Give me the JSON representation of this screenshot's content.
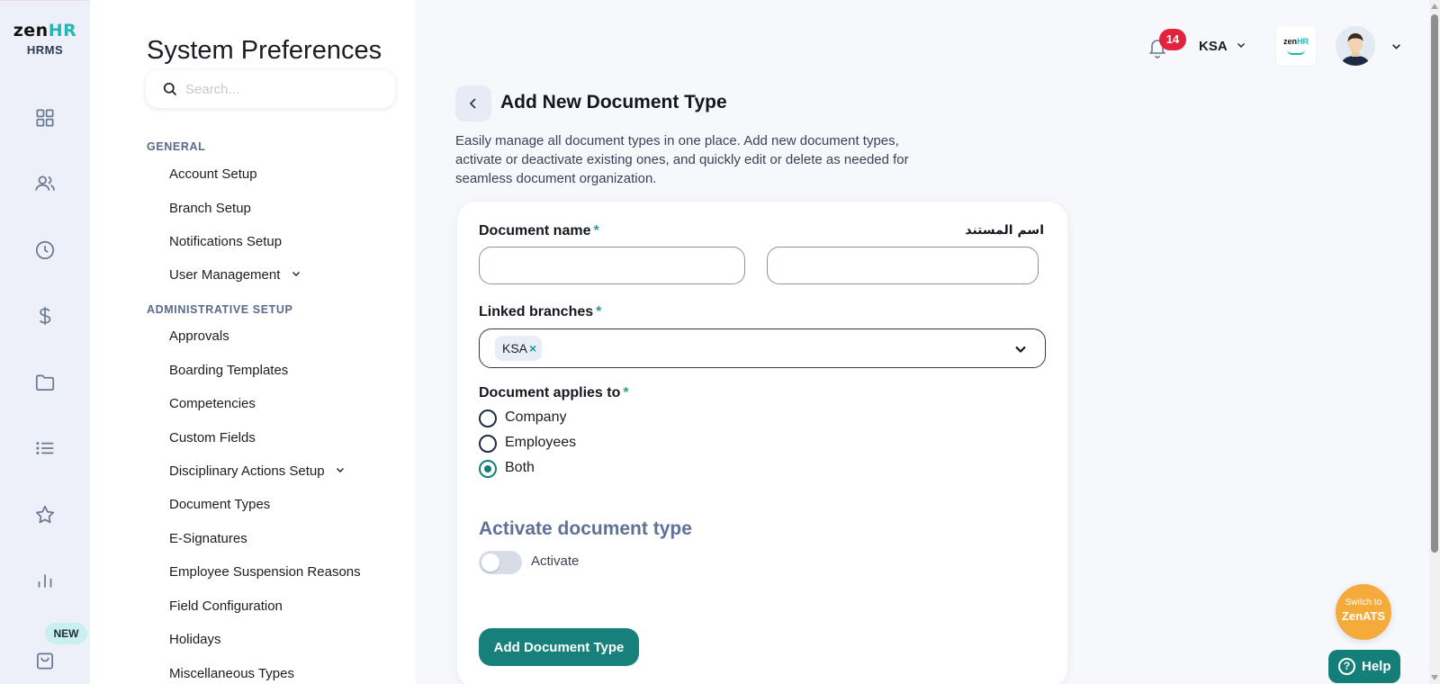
{
  "brand": {
    "logo_main": "zen",
    "logo_accent": "HR",
    "subtitle": "HRMS"
  },
  "rail": {
    "icons": [
      "dashboard-icon",
      "people-icon",
      "clock-icon",
      "dollar-icon",
      "folder-icon",
      "list-icon",
      "star-icon",
      "chart-icon",
      "bag-icon"
    ],
    "new_badge": "NEW"
  },
  "menu": {
    "title": "System Preferences",
    "search_placeholder": "Search...",
    "sections": [
      {
        "label": "GENERAL",
        "items": [
          "Account Setup",
          "Branch Setup",
          "Notifications Setup",
          "User Management"
        ]
      },
      {
        "label": "ADMINISTRATIVE SETUP",
        "items": [
          "Approvals",
          "Boarding Templates",
          "Competencies",
          "Custom Fields",
          "Disciplinary Actions Setup",
          "Document Types",
          "E-Signatures",
          "Employee Suspension Reasons",
          "Field Configuration",
          "Holidays",
          "Miscellaneous Types"
        ]
      }
    ]
  },
  "topbar": {
    "notification_count": "14",
    "country": "KSA",
    "company_logo_main": "zen",
    "company_logo_accent": "HR"
  },
  "page": {
    "title": "Add New Document Type",
    "description": "Easily manage all document types in one place. Add new document types, activate or deactivate existing ones, and quickly edit or delete as needed for seamless document organization."
  },
  "form": {
    "document_name_label": "Document name",
    "required_mark": "*",
    "arabic_label": "اسم المستند",
    "document_name_value": "",
    "arabic_name_value": "",
    "linked_branches_label": "Linked branches",
    "linked_branches_selected": [
      "KSA"
    ],
    "chip_remove": "×",
    "applies_to_label": "Document applies to",
    "applies_to_options": [
      "Company",
      "Employees",
      "Both"
    ],
    "applies_to_selected": "Both",
    "activate_title": "Activate document type",
    "activate_label": "Activate",
    "activate_on": false,
    "submit_label": "Add Document Type"
  },
  "floating": {
    "switch_line1": "Switch to",
    "switch_line2": "ZenATS",
    "help_icon": "?",
    "help_label": "Help"
  },
  "colors": {
    "accent": "#17807a",
    "brand_teal": "#23b7b2",
    "notification_red": "#e1233c",
    "switch_orange": "#f5ab3b"
  }
}
